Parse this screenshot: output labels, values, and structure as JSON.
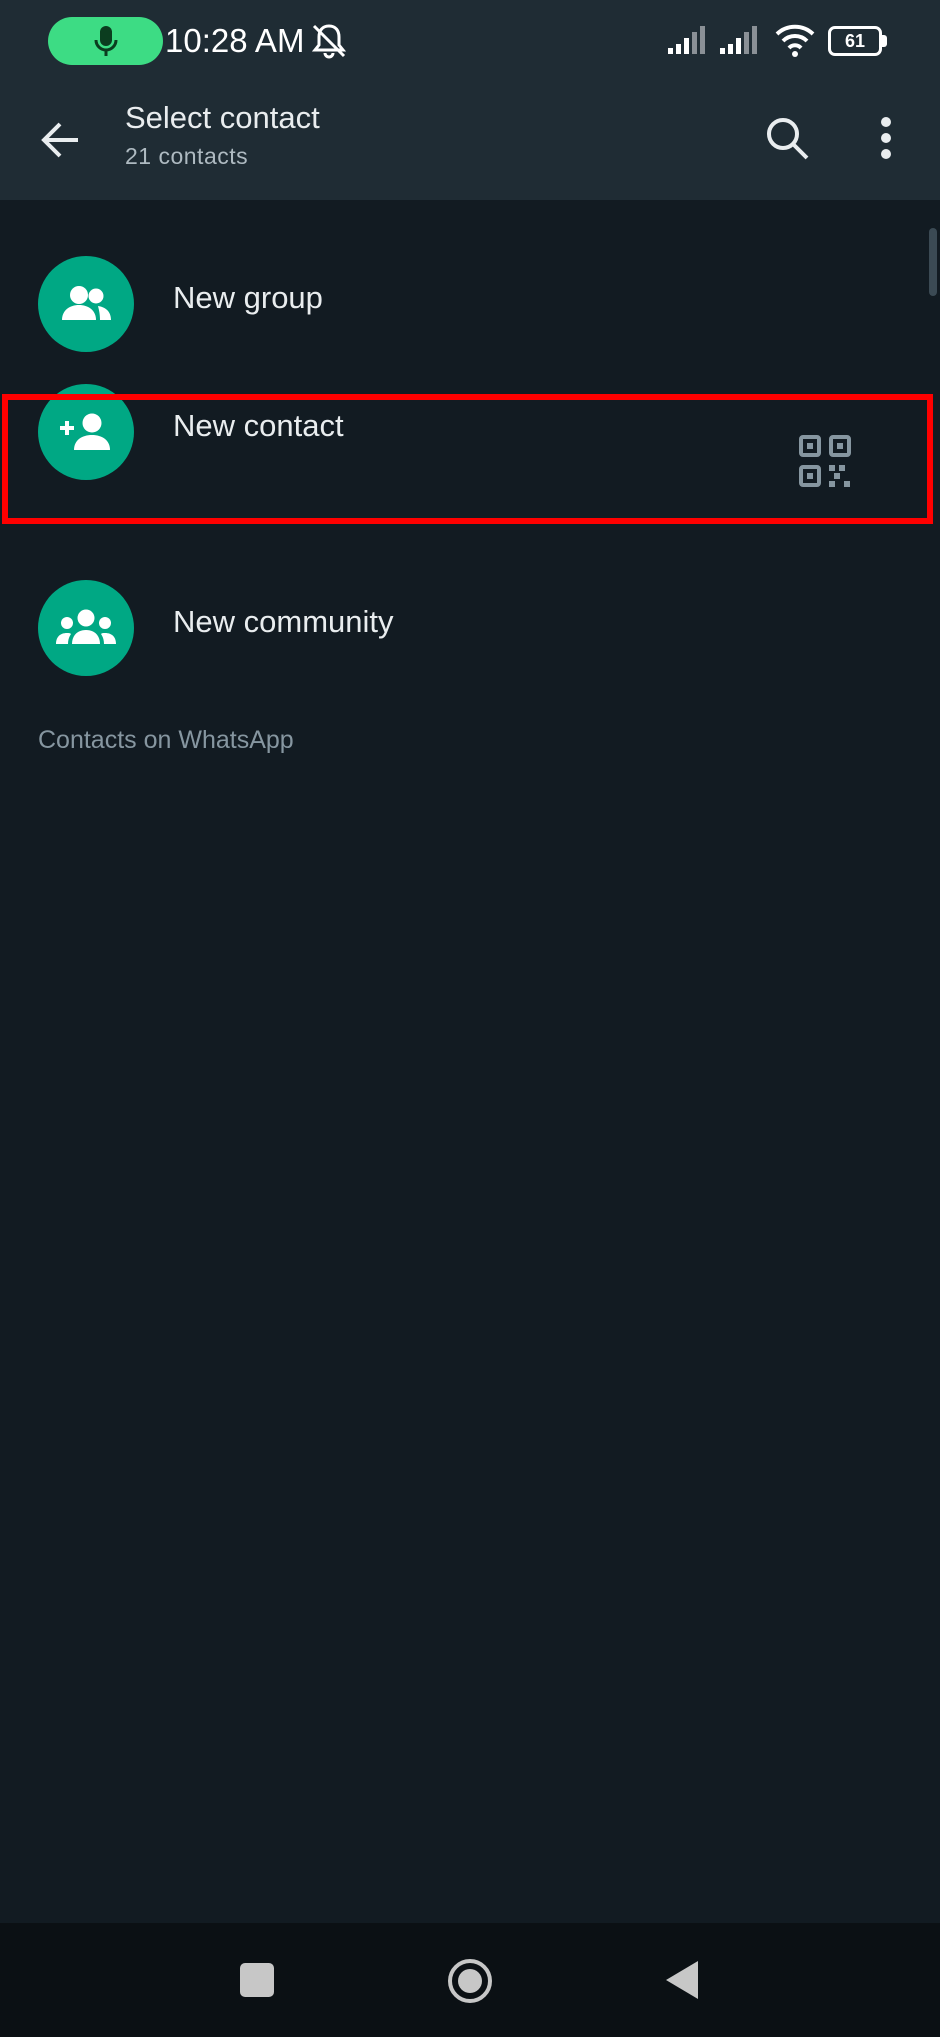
{
  "status_bar": {
    "time": "10:28 AM",
    "battery": "61",
    "icons": [
      "mic-icon",
      "bell-off-icon",
      "signal-icon",
      "signal-icon",
      "wifi-icon",
      "battery-icon"
    ]
  },
  "app_bar": {
    "title": "Select contact",
    "subtitle": "21 contacts",
    "icons": [
      "back-arrow-icon",
      "search-icon",
      "more-vert-icon"
    ]
  },
  "actions": [
    {
      "label": "New group",
      "icon": "group-icon"
    },
    {
      "label": "New contact",
      "icon": "person-add-icon",
      "trailing_icon": "qr-code-icon"
    },
    {
      "label": "New community",
      "icon": "community-icon"
    }
  ],
  "section_header": "Contacts on WhatsApp",
  "nav_bar": {
    "icons": [
      "recents-icon",
      "home-icon",
      "back-triangle-icon"
    ]
  },
  "colors": {
    "background": "#121b22",
    "bar": "#1f2c34",
    "accent": "#00a884",
    "highlight": "#ff0000",
    "mic_pill": "#3ddc84"
  }
}
